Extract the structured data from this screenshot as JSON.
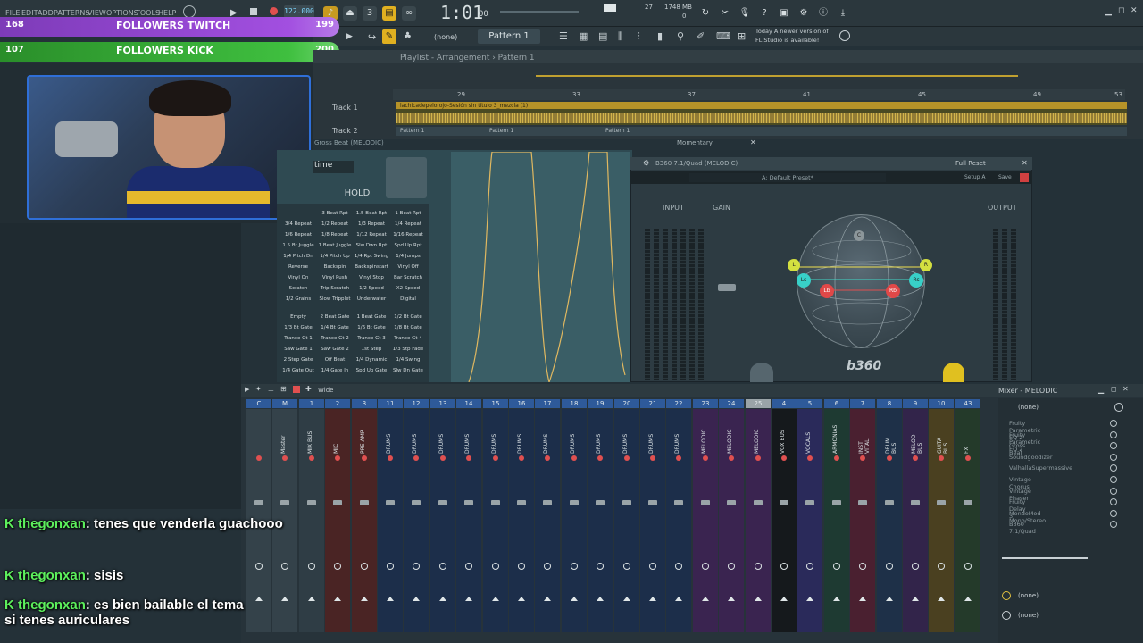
{
  "topbar": {
    "menus": [
      "FILE",
      "EDIT",
      "ADD",
      "PATTERNS",
      "VIEW",
      "OPTIONS",
      "TOOLS",
      "HELP"
    ],
    "tempo": "122.000",
    "time": "1:01",
    "time_small": "00",
    "cpu": "27",
    "mem": "1748 MB",
    "voices": "0",
    "news_line1": "Today  A newer version of",
    "news_line2": "FL Studio is available!"
  },
  "toolbar2": {
    "snap": "(none)",
    "pattern": "Pattern 1"
  },
  "followers": {
    "twitch_label": "FOLLOWERS TWITCH",
    "twitch_current": "168",
    "twitch_goal": "199",
    "kick_label": "FOLLOWERS KICK",
    "kick_current": "107",
    "kick_goal": "200",
    "twitch_color": "#a24fe0",
    "kick_color": "#3fbf3f"
  },
  "playlist": {
    "title": "Playlist - Arrangement › Pattern 1",
    "ruler": [
      "29",
      "33",
      "37",
      "41",
      "45",
      "49",
      "53"
    ],
    "track1": "Track 1",
    "track2": "Track 2",
    "clip": "lachicadepelorojo-Sesión sin título 3_mezcla (1)",
    "pattern_clips": [
      "Pattern 1",
      "Pattern 1",
      "Pattern 1"
    ]
  },
  "grossbeat": {
    "title": "Gross Beat (MELODIC)",
    "time_label": "time",
    "hold": "HOLD",
    "mode": "Momentary",
    "time_presets": [
      [
        "",
        "3 Beat Rpt",
        "1.5 Beat Rpt",
        "1 Beat Rpt"
      ],
      [
        "3/4 Repeat",
        "1/2 Repeat",
        "1/3 Repeat",
        "1/4 Repeat"
      ],
      [
        "1/6 Repeat",
        "1/8 Repeat",
        "1/12 Repeat",
        "1/16 Repeat"
      ],
      [
        "1.5 Bt Juggle",
        "1 Beat Juggle",
        "Slw Dwn Rpt",
        "Spd Up Rpt"
      ],
      [
        "1/4 Pitch Dn",
        "1/4 Pitch Up",
        "1/4 Rpt Swing",
        "1/4 Jumps"
      ],
      [
        "Reverse",
        "Backspin",
        "Backspinstart",
        "Vinyl Off"
      ],
      [
        "Vinyl On",
        "Vinyl Push",
        "Vinyl Stop",
        "Bar Scratch"
      ],
      [
        "Scratch",
        "Trip Scratch",
        "1/2 Speed",
        "X2 Speed"
      ],
      [
        "1/2 Grains",
        "Slow Tripplet",
        "Underwater",
        "Digital"
      ]
    ],
    "volume_presets": [
      [
        "Empty",
        "2 Beat Gate",
        "1 Beat Gate",
        "1/2 Bt Gate"
      ],
      [
        "1/3 Bt Gate",
        "1/4 Bt Gate",
        "1/6 Bt Gate",
        "1/8 Bt Gate"
      ],
      [
        "Trance Gt 1",
        "Trance Gt 2",
        "Trance Gt 3",
        "Trance Gt 4"
      ],
      [
        "Saw Gate 1",
        "Saw Gate 2",
        "1st Step",
        "1/3 Stp Fade"
      ],
      [
        "2 Step Gate",
        "Off Beat",
        "1/4 Dynamic",
        "1/4 Swing"
      ],
      [
        "1/4 Gate Out",
        "1/4 Gate In",
        "Spd Up Gate",
        "Slw Dn Gate"
      ]
    ]
  },
  "b360": {
    "title": "B360 7.1/Quad (MELODIC)",
    "full_reset": "Full Reset",
    "preset": "A: Default Preset*",
    "setup": "Setup A",
    "save": "Save",
    "input": "INPUT",
    "gain": "GAIN",
    "output": "OUTPUT",
    "logo": "b360",
    "speakers": [
      "C",
      "L",
      "R",
      "Ls",
      "Rs",
      "Lb",
      "Rb"
    ]
  },
  "mixer": {
    "title": "Mixer - MELODIC",
    "width_mode": "Wide",
    "channels": [
      {
        "num": "C",
        "name": "",
        "color": "#34424a"
      },
      {
        "num": "M",
        "name": "Master",
        "color": "#34424a"
      },
      {
        "num": "1",
        "name": "MIX BUS",
        "color": "#2f3d45"
      },
      {
        "num": "2",
        "name": "MIC",
        "color": "#4a2424"
      },
      {
        "num": "3",
        "name": "PRE AMP",
        "color": "#4a2424"
      },
      {
        "num": "11",
        "name": "DRUMS",
        "color": "#1c2e4a"
      },
      {
        "num": "12",
        "name": "DRUMS",
        "color": "#1c2e4a"
      },
      {
        "num": "13",
        "name": "DRUMS",
        "color": "#1c2e4a"
      },
      {
        "num": "14",
        "name": "DRUMS",
        "color": "#1c2e4a"
      },
      {
        "num": "15",
        "name": "DRUMS",
        "color": "#1c2e4a"
      },
      {
        "num": "16",
        "name": "DRUMS",
        "color": "#1c2e4a"
      },
      {
        "num": "17",
        "name": "DRUMS",
        "color": "#1c2e4a"
      },
      {
        "num": "18",
        "name": "DRUMS",
        "color": "#1c2e4a"
      },
      {
        "num": "19",
        "name": "DRUMS",
        "color": "#1c2e4a"
      },
      {
        "num": "20",
        "name": "DRUMS",
        "color": "#1c2e4a"
      },
      {
        "num": "21",
        "name": "DRUMS",
        "color": "#1c2e4a"
      },
      {
        "num": "22",
        "name": "DRUMS",
        "color": "#1c2e4a"
      },
      {
        "num": "23",
        "name": "MELODIC",
        "color": "#3a2450"
      },
      {
        "num": "24",
        "name": "MELODIC",
        "color": "#3a2450"
      },
      {
        "num": "25",
        "name": "MELODIC",
        "color": "#3a2450"
      },
      {
        "num": "4",
        "name": "VOX BUS",
        "color": "#15191c"
      },
      {
        "num": "5",
        "name": "VOCALS",
        "color": "#2a2a5a"
      },
      {
        "num": "6",
        "name": "ARMONIAS",
        "color": "#1e3a32"
      },
      {
        "num": "7",
        "name": "INST VITAL",
        "color": "#4a2030"
      },
      {
        "num": "8",
        "name": "DRUM BUS",
        "color": "#1e3048"
      },
      {
        "num": "9",
        "name": "MELOD BUS",
        "color": "#32244a"
      },
      {
        "num": "10",
        "name": "GUITA BUS",
        "color": "#4a4020"
      },
      {
        "num": "43",
        "name": "FX",
        "color": "#243a2a"
      }
    ],
    "fx_slots": [
      "(none)",
      "Fruity Parametric EQ 2",
      "Fruity Parametric EQ 2",
      "Gross Beat",
      "Soundgoodizer",
      "ValhallaSupermassive",
      "Vintage Chorus",
      "Vintage Phaser",
      "Fruity Delay 3",
      "MondoMod Mono/Stereo",
      "B360 7.1/Quad"
    ],
    "out_slots": [
      "(none)",
      "(none)"
    ]
  },
  "chat": [
    {
      "user": "thegonxan",
      "message": ": tenes que venderla guachooo"
    },
    {
      "user": "thegonxan",
      "message": ": sisis"
    },
    {
      "user": "thegonxan",
      "message": ": es bien bailable el tema si tenes auriculares"
    }
  ],
  "chat_badge": "K"
}
